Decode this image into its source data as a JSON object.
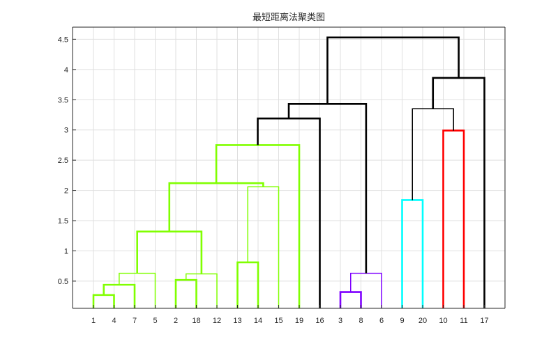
{
  "chart_data": {
    "type": "dendrogram",
    "title": "最短距离法聚类图",
    "xlabel": "",
    "ylabel": "",
    "ylim": [
      0.05,
      4.7
    ],
    "yticks": [
      0.5,
      1,
      1.5,
      2,
      2.5,
      3,
      3.5,
      4,
      4.5
    ],
    "grid": true,
    "leaf_order": [
      "1",
      "4",
      "7",
      "5",
      "2",
      "18",
      "12",
      "13",
      "14",
      "15",
      "19",
      "16",
      "3",
      "8",
      "6",
      "9",
      "20",
      "10",
      "11",
      "17"
    ],
    "merges": [
      {
        "left": "1",
        "right": "4",
        "height": 0.27,
        "color": "#80ff00"
      },
      {
        "left": "(1,4)",
        "right": "7",
        "height": 0.44,
        "color": "#80ff00"
      },
      {
        "left": "(1,4,7)",
        "right": "5",
        "height": 0.63,
        "color": "#80ff00"
      },
      {
        "left": "2",
        "right": "18",
        "height": 0.52,
        "color": "#80ff00"
      },
      {
        "left": "(2,18)",
        "right": "12",
        "height": 0.62,
        "color": "#80ff00"
      },
      {
        "left": "(1,4,7,5)",
        "right": "(2,18,12)",
        "height": 1.32,
        "color": "#80ff00"
      },
      {
        "left": "13",
        "right": "14",
        "height": 0.81,
        "color": "#80ff00"
      },
      {
        "left": "(13,14)",
        "right": "15",
        "height": 2.06,
        "color": "#80ff00"
      },
      {
        "left": "(1,4,7,5,2,18,12)",
        "right": "(13,14,15)",
        "height": 2.12,
        "color": "#80ff00"
      },
      {
        "left": "(1..15)",
        "right": "19",
        "height": 2.75,
        "color": "#80ff00"
      },
      {
        "left": "(1..19)",
        "right": "16",
        "height": 3.19,
        "color": "#000000"
      },
      {
        "left": "3",
        "right": "8",
        "height": 0.32,
        "color": "#7f00ff"
      },
      {
        "left": "(3,8)",
        "right": "6",
        "height": 0.63,
        "color": "#7f00ff"
      },
      {
        "left": "(1..16)",
        "right": "(3,8,6)",
        "height": 3.43,
        "color": "#000000"
      },
      {
        "left": "9",
        "right": "20",
        "height": 1.84,
        "color": "#00ffff"
      },
      {
        "left": "10",
        "right": "11",
        "height": 2.99,
        "color": "#ff0000"
      },
      {
        "left": "(9,20)",
        "right": "(10,11)",
        "height": 3.35,
        "color": "#000000"
      },
      {
        "left": "(9,20,10,11)",
        "right": "17",
        "height": 3.86,
        "color": "#000000"
      },
      {
        "left": "(1..6)",
        "right": "(9..17)",
        "height": 4.53,
        "color": "#000000"
      }
    ]
  }
}
